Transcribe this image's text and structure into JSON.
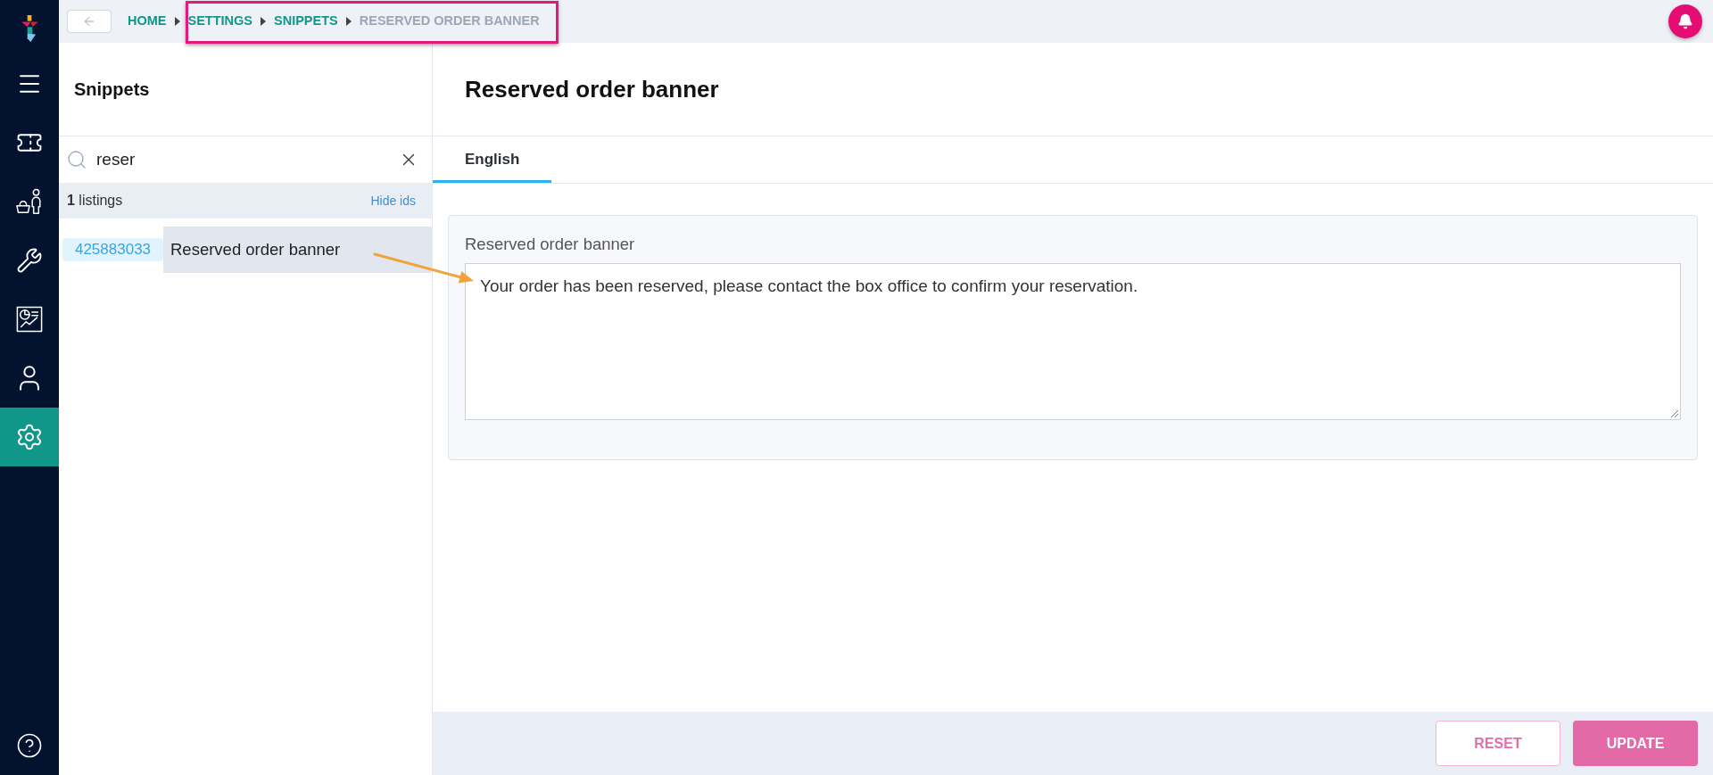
{
  "top_bar": {
    "breadcrumbs": [
      {
        "label": "HOME",
        "current": false
      },
      {
        "label": "SETTINGS",
        "current": false
      },
      {
        "label": "SNIPPETS",
        "current": false
      },
      {
        "label": "RESERVED ORDER BANNER",
        "current": true
      }
    ]
  },
  "nav": {
    "items": [
      {
        "selected": false
      },
      {
        "selected": false
      },
      {
        "selected": false
      },
      {
        "selected": false
      },
      {
        "selected": false
      },
      {
        "selected": true
      }
    ]
  },
  "snippets_panel": {
    "title": "Snippets",
    "search": {
      "value": "reser"
    },
    "count": "**1** listings",
    "ids_toggle": "Hide ids",
    "items": [
      {
        "id": "425883033",
        "label": "Reserved order banner",
        "selected": true
      }
    ]
  },
  "editor": {
    "title": "Reserved order banner",
    "tabs": [
      {
        "label": "English",
        "selected": true
      }
    ],
    "field": {
      "label": "Reserved order banner",
      "value": "Your order has been reserved, please contact the box office to confirm your reservation."
    }
  },
  "footer": {
    "buttons": [
      {
        "label": "RESET",
        "kind": "secondary",
        "disabled": true
      },
      {
        "label": "UPDATE",
        "kind": "primary",
        "disabled": true
      }
    ]
  }
}
